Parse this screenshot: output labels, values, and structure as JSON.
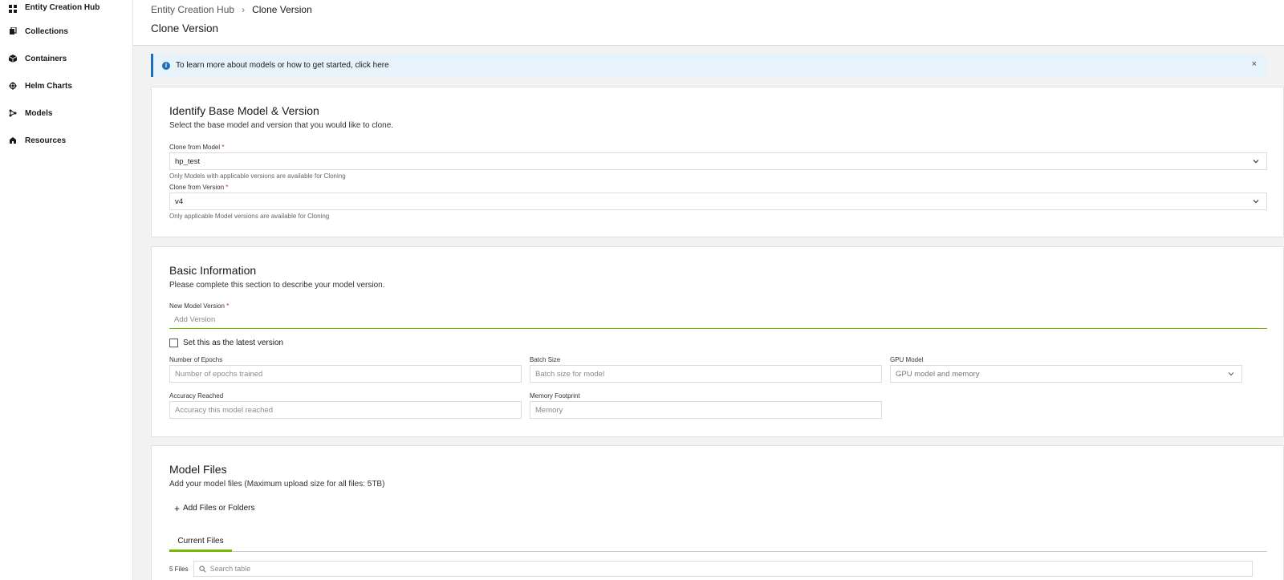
{
  "sidebar": {
    "items": [
      {
        "label": "Entity Creation Hub",
        "icon": "grid-icon"
      },
      {
        "label": "Collections",
        "icon": "collections-icon"
      },
      {
        "label": "Containers",
        "icon": "container-cube-icon"
      },
      {
        "label": "Helm Charts",
        "icon": "helm-wheel-icon"
      },
      {
        "label": "Models",
        "icon": "model-network-icon"
      },
      {
        "label": "Resources",
        "icon": "resources-icon"
      }
    ]
  },
  "header": {
    "breadcrumb": {
      "parent": "Entity Creation Hub",
      "current": "Clone Version"
    },
    "title": "Clone Version"
  },
  "banner": {
    "text": "To learn more about models or how to get started, click here",
    "close": "×"
  },
  "base_section": {
    "title": "Identify Base Model & Version",
    "description": "Select the base model and version that you would like to clone.",
    "model_label": "Clone from Model",
    "model_value": "hp_test",
    "model_helper": "Only Models with applicable versions are available for Cloning",
    "version_label": "Clone from Version",
    "version_value": "v4",
    "version_helper": "Only applicable Model versions are available for Cloning",
    "required_mark": "*"
  },
  "basic_section": {
    "title": "Basic Information",
    "description": "Please complete this section to describe your model version.",
    "new_version_label": "New Model Version",
    "new_version_placeholder": "Add Version",
    "latest_checkbox_label": "Set this as the latest version",
    "epochs_label": "Number of Epochs",
    "epochs_placeholder": "Number of epochs trained",
    "batch_label": "Batch Size",
    "batch_placeholder": "Batch size for model",
    "gpu_label": "GPU Model",
    "gpu_placeholder": "GPU model and memory",
    "accuracy_label": "Accuracy Reached",
    "accuracy_placeholder": "Accuracy this model reached",
    "memory_label": "Memory Footprint",
    "memory_placeholder": "Memory",
    "required_mark": "*"
  },
  "files_section": {
    "title": "Model Files",
    "description": "Add your model files (Maximum upload size for all files: 5TB)",
    "add_button": "Add Files or Folders",
    "tab_current": "Current Files",
    "files_count": "5 Files",
    "search_placeholder": "Search table"
  },
  "colors": {
    "accent_green": "#76b900",
    "info_blue": "#1f6fb8",
    "banner_bg": "#e7f3fb",
    "required_red": "#c62828"
  }
}
